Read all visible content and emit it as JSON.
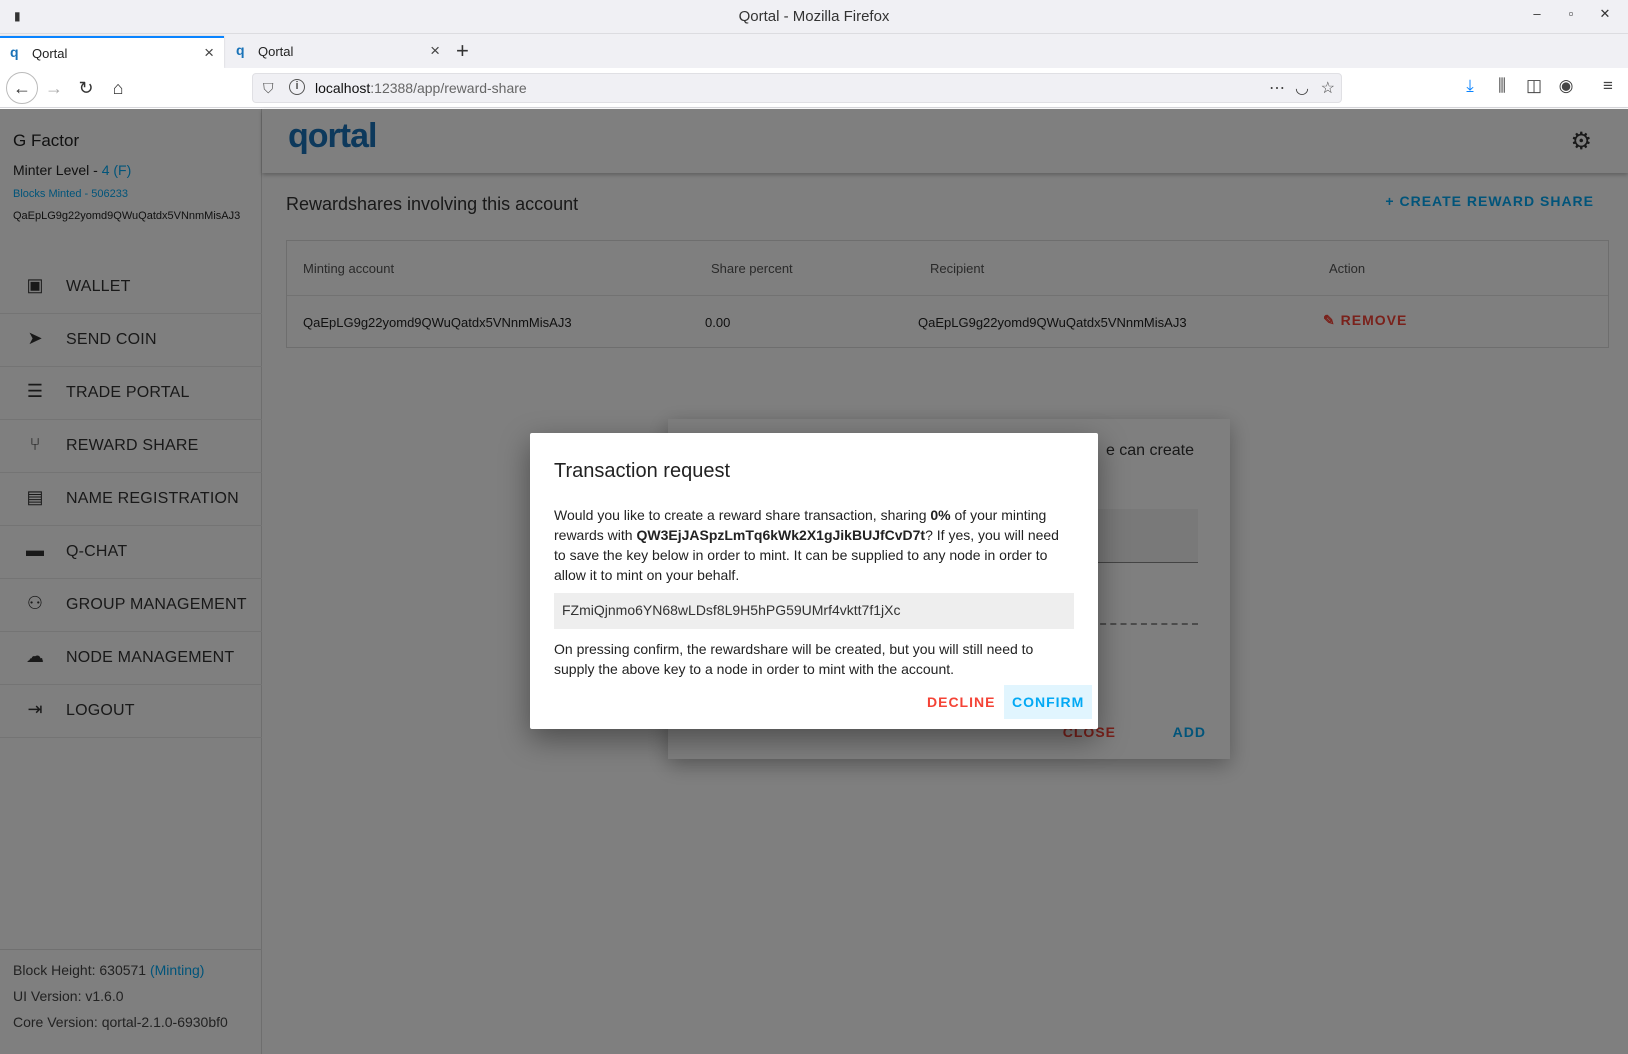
{
  "window": {
    "title": "Qortal - Mozilla Firefox",
    "menu_glyph": "▮",
    "min": "‒",
    "max": "▫",
    "close": "✕"
  },
  "tabs": [
    {
      "label": "Qortal",
      "active": true
    },
    {
      "label": "Qortal",
      "active": false
    }
  ],
  "urlbar": {
    "host": "localhost",
    "path": ":12388/app/reward-share"
  },
  "profile": {
    "name": "G Factor",
    "minter_level_label": "Minter Level - ",
    "minter_level_value": "4 (F)",
    "blocks_minted": "Blocks Minted - 506233",
    "address": "QaEpLG9g22yomd9QWuQatdx5VNnmMisAJ3"
  },
  "menu": [
    {
      "label": "WALLET",
      "icon": "wallet-icon",
      "glyph": "▣"
    },
    {
      "label": "SEND COIN",
      "icon": "send-icon",
      "glyph": "➤"
    },
    {
      "label": "TRADE PORTAL",
      "icon": "list-icon",
      "glyph": "☰"
    },
    {
      "label": "REWARD SHARE",
      "icon": "call-split-icon",
      "glyph": "⑂"
    },
    {
      "label": "NAME REGISTRATION",
      "icon": "badge-icon",
      "glyph": "▤"
    },
    {
      "label": "Q-CHAT",
      "icon": "chat-icon",
      "glyph": "▬"
    },
    {
      "label": "GROUP MANAGEMENT",
      "icon": "group-icon",
      "glyph": "⚇"
    },
    {
      "label": "NODE MANAGEMENT",
      "icon": "cloud-icon",
      "glyph": "☁"
    },
    {
      "label": "LOGOUT",
      "icon": "logout-icon",
      "glyph": "⇥"
    }
  ],
  "status": {
    "block_height_label": "Block Height: 630571 ",
    "block_height_state": "(Minting)",
    "ui_version": "UI Version: v1.6.0",
    "core_version": "Core Version: qortal-2.1.0-6930bf0"
  },
  "header": {
    "logo": "qortal"
  },
  "page": {
    "section_title": "Rewardshares involving this account",
    "create_button": "+ CREATE REWARD SHARE",
    "columns": [
      "Minting account",
      "Share percent",
      "Recipient",
      "Action"
    ],
    "rows": [
      {
        "minting_account": "QaEpLG9g22yomd9QWuQatdx5VNnmMisAJ3",
        "share_percent": "0.00",
        "recipient": "QaEpLG9g22yomd9QWuQatdx5VNnmMisAJ3",
        "action": "✎ REMOVE"
      }
    ]
  },
  "bg_dialog": {
    "partial_text": "e can create",
    "close": "CLOSE",
    "add": "ADD"
  },
  "dialog": {
    "title": "Transaction request",
    "body_1": "Would you like to create a reward share transaction, sharing ",
    "percent": "0%",
    "body_2": " of your minting rewards with ",
    "recipient": "QW3EjJASpzLmTq6kWk2X1gJikBUJfCvD7t",
    "body_3": "? If yes, you will need to save the key below in order to mint. It can be supplied to any node in order to allow it to mint on your behalf.",
    "key": "FZmiQjnmo6YN68wLDsf8L9H5hPG59UMrf4vktt7f1jXc",
    "note": "On pressing confirm, the rewardshare will be created, but you will still need to supply the above key to a node in order to mint with the account.",
    "decline": "DECLINE",
    "confirm": "CONFIRM"
  },
  "colors": {
    "accent": "#03a9f4",
    "danger": "#f44336",
    "brand": "#1a73b8"
  }
}
